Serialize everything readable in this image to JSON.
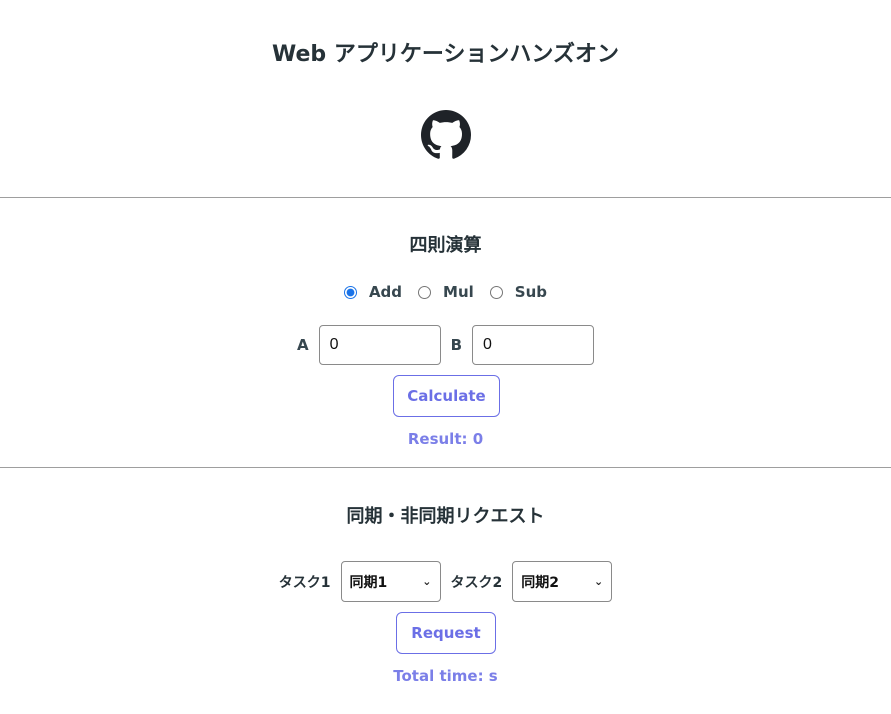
{
  "header": {
    "title": "Web アプリケーションハンズオン",
    "github_icon": "github-icon"
  },
  "arithmetic": {
    "title": "四則演算",
    "operations": [
      {
        "label": "Add",
        "selected": true
      },
      {
        "label": "Mul",
        "selected": false
      },
      {
        "label": "Sub",
        "selected": false
      }
    ],
    "a_label": "A",
    "a_value": "0",
    "b_label": "B",
    "b_value": "0",
    "calculate_label": "Calculate",
    "result_text": "Result: 0"
  },
  "requests": {
    "title": "同期・非同期リクエスト",
    "task1_label": "タスク1",
    "task1_value": "同期1",
    "task2_label": "タスク2",
    "task2_value": "同期2",
    "request_label": "Request",
    "total_time_text": "Total time: s"
  },
  "colors": {
    "accent": "#6b6fe6",
    "text": "#263238",
    "radio": "#1a73e8"
  }
}
